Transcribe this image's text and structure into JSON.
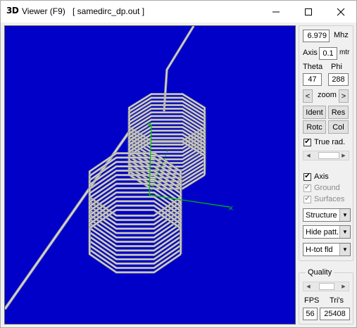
{
  "window": {
    "app_icon": "3D",
    "title": "Viewer (F9)",
    "file": "[  samedirc_dp.out ]",
    "minimize_icon": "minimize-icon",
    "maximize_icon": "maximize-icon",
    "close_icon": "close-icon"
  },
  "panel": {
    "frequency": {
      "value": "6.979",
      "unit": "Mhz"
    },
    "axis": {
      "label": "Axis",
      "value": "0.1",
      "unit": "mtr"
    },
    "theta": {
      "label": "Theta",
      "value": "47"
    },
    "phi": {
      "label": "Phi",
      "value": "288"
    },
    "zoom": {
      "label": "zoom",
      "left": "<",
      "right": ">"
    },
    "buttons": {
      "ident": "Ident",
      "res": "Res",
      "rotc": "Rotc",
      "col": "Col"
    },
    "true_rad": {
      "label": "True rad.",
      "checked": true
    },
    "slider1_position": 0.45,
    "checks": {
      "axis": {
        "label": "Axis",
        "checked": true,
        "enabled": true
      },
      "ground": {
        "label": "Ground",
        "checked": true,
        "enabled": false
      },
      "surfaces": {
        "label": "Surfaces",
        "checked": true,
        "enabled": false
      }
    },
    "dropdowns": {
      "structure": "Structure",
      "pattern": "Hide patt.",
      "field": "H-tot fld"
    },
    "quality": {
      "label": "Quality",
      "slider_position": 0.4,
      "fps_label": "FPS",
      "tris_label": "Tri's",
      "fps": "56",
      "tris": "25408"
    }
  },
  "colors": {
    "viewport_bg": "#0000c8",
    "wire": "#d8d8d8",
    "axis_green": "#00c000"
  }
}
